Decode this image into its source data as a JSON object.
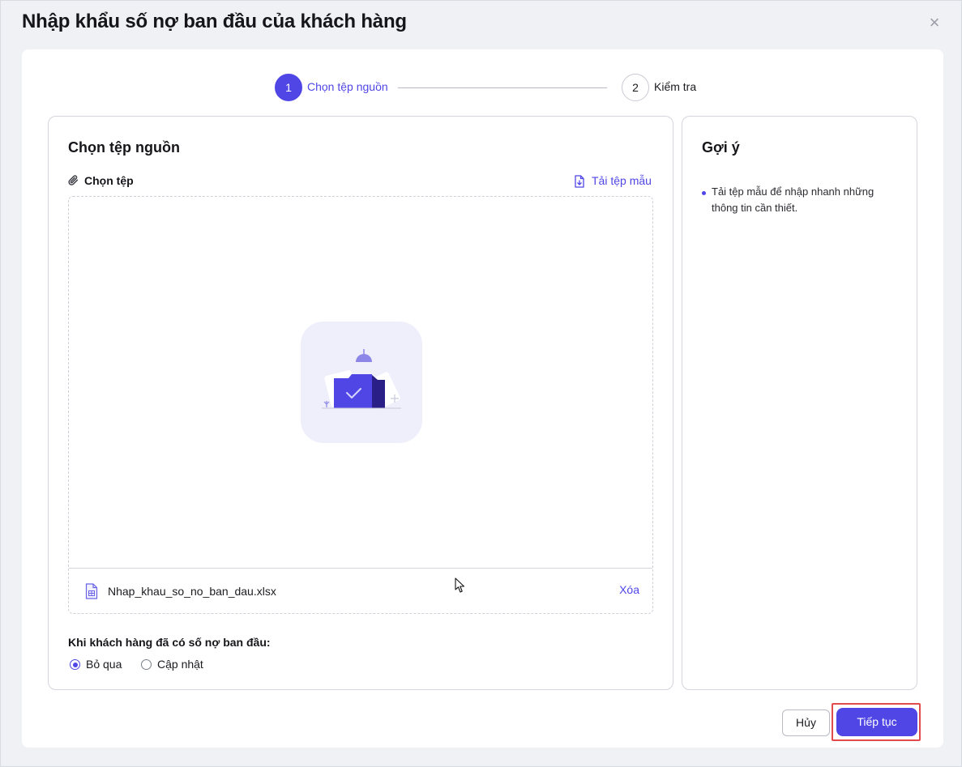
{
  "dialog": {
    "title": "Nhập khẩu số nợ ban đầu của khách hàng",
    "close_glyph": "×"
  },
  "stepper": {
    "steps": [
      {
        "number": "1",
        "label": "Chọn tệp nguồn",
        "active": true
      },
      {
        "number": "2",
        "label": "Kiểm tra",
        "active": false
      }
    ]
  },
  "source": {
    "title": "Chọn tệp nguồn",
    "choose_label": "Chọn tệp",
    "template_label": "Tải tệp mẫu",
    "file_name": "Nhap_khau_so_no_ban_dau.xlsx",
    "delete_label": "Xóa",
    "exist_label": "Khi khách hàng đã có số nợ ban đầu:",
    "options": [
      {
        "label": "Bỏ qua",
        "checked": true
      },
      {
        "label": "Cập nhật",
        "checked": false
      }
    ]
  },
  "hint": {
    "title": "Gợi ý",
    "items": [
      "Tải tệp mẫu để nhập nhanh những thông tin cần thiết."
    ]
  },
  "footer": {
    "cancel_label": "Hủy",
    "continue_label": "Tiếp tục"
  },
  "colors": {
    "accent": "#4f46e5",
    "highlight": "#e24b4b"
  },
  "icons": [
    "close-icon",
    "paperclip-icon",
    "download-file-icon",
    "folder-check-icon",
    "xlsx-file-icon",
    "mouse-cursor-icon"
  ]
}
